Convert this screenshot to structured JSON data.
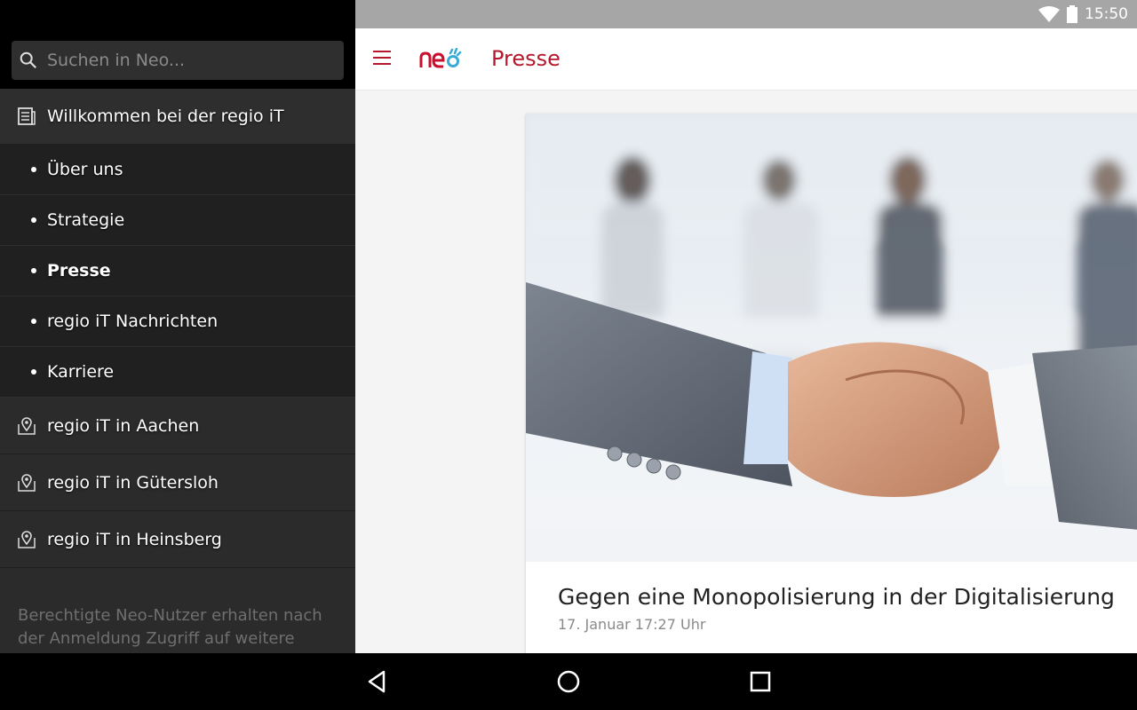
{
  "status_bar": {
    "time": "15:50"
  },
  "drawer": {
    "search_placeholder": "Suchen in Neo...",
    "section_title": "Willkommen bei der regio iT",
    "sub_items": [
      {
        "label": "Über uns"
      },
      {
        "label": "Strategie"
      },
      {
        "label": "Presse"
      },
      {
        "label": "regio iT Nachrichten"
      },
      {
        "label": "Karriere"
      }
    ],
    "locations": [
      {
        "label": "regio iT in Aachen"
      },
      {
        "label": "regio iT in Gütersloh"
      },
      {
        "label": "regio iT in Heinsberg"
      }
    ],
    "footer_text": "Berechtigte Neo-Nutzer erhalten nach der Anmeldung Zugriff auf weitere"
  },
  "appbar": {
    "logo_text": "neo",
    "title": "Presse"
  },
  "article": {
    "headline": "Gegen eine Monopolisierung in der Digitalisierung",
    "date": "17. Januar 17:27 Uhr"
  },
  "colors": {
    "accent": "#b5172d",
    "logo_red": "#c8102e",
    "logo_blue": "#39a9d6"
  },
  "icons": {
    "search": "search-icon",
    "news": "newspaper-icon",
    "location": "map-pin-icon",
    "menu": "hamburger-icon",
    "nav_back": "back-icon",
    "nav_home": "home-icon",
    "nav_recents": "recents-icon"
  }
}
